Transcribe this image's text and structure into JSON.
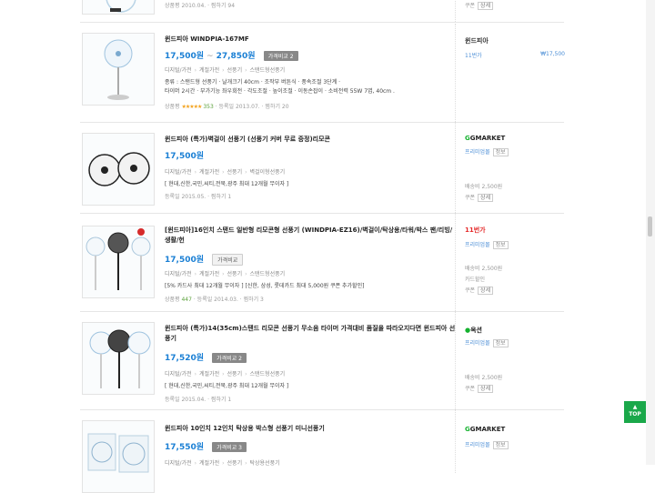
{
  "partial_top": {
    "meta": "상품평 2010.04.",
    "wish": "찜하기 94",
    "coupon": "쿠폰",
    "detail": "상세"
  },
  "items": [
    {
      "title": "윈드피아 WINDPIA-167MF",
      "price": "17,500원",
      "price_max": "27,850원",
      "compare": "가격비교 2",
      "category": [
        "디지털/가전",
        "계절가전",
        "선풍기",
        "스탠드형선풍기"
      ],
      "spec_lines": [
        "종류 : 스탠드형 선풍기 · 날개크기 40cm · 조작부 버튼식 · 풍속조절 3단계 ·",
        "타이머 2시간 · 부가기능 좌우회전 · 각도조절 · 높이조절 · 이동손잡이 · 소비전력 55W 7엽, 40cm ."
      ],
      "meta_label": "상품평",
      "review_count": "353",
      "stars": "★★★★★",
      "date": "등록일 2013.07.",
      "wish": "찜하기 20",
      "mall": "윈드피아",
      "mall_sub": "11번가",
      "mall_price": "₩17,500"
    },
    {
      "title": "윈드피아 (특가)벽걸이 선풍기 (선풍기 커버 무료 증정)리모콘",
      "price": "17,500원",
      "category": [
        "디지털/가전",
        "계절가전",
        "선풍기",
        "벽걸이형선풍기"
      ],
      "card": "[ 현대,신한,국민,씨티,전북,광주 최대 12개월 무이자 ]",
      "date": "등록일 2015.05.",
      "wish": "찜하기 1",
      "mall_brand": "GMARKET",
      "mall_sub": "프리미엄몰",
      "mall_tag": "정보",
      "ship": "배송비 2,500원",
      "coupon": "쿠폰",
      "detail": "상세"
    },
    {
      "title": "[윈드피아]16인치 스탠드 일반형 리모콘형 선풍기 (WINDPIA-EZ16)/벽걸이/탁상용/타워/박스 팬/리빙/생활/헌",
      "price": "17,500원",
      "compare": "가격비교",
      "category": [
        "디지털/가전",
        "계절가전",
        "선풍기",
        "스탠드형선풍기"
      ],
      "card": "[5% 카드사 최대 12개월 무이자 ] [신한, 삼성, 롯데카드 최대 5,000원 쿠폰 추가할인]",
      "meta_label": "상품평",
      "review_count": "447",
      "date": "등록일 2014.03.",
      "wish": "찜하기 3",
      "mall_brand": "11번가",
      "mall_sub": "프리미엄몰",
      "mall_tag": "정보",
      "ship": "배송비 2,500원",
      "card_note": "카드할인",
      "coupon": "쿠폰",
      "detail": "상세"
    },
    {
      "title": "윈드피아 (특가)14(35cm)스탠드 리모콘 선풍기 무소음 타이머 가격대비 품질을 따라오지다면 윈드피아 선풍기",
      "price": "17,520원",
      "compare": "가격비교 2",
      "category": [
        "디지털/가전",
        "계절가전",
        "선풍기",
        "스탠드형선풍기"
      ],
      "card": "[ 현대,신한,국민,씨티,전북,광주 최대 12개월 무이자 ]",
      "date": "등록일 2015.04.",
      "wish": "찜하기 1",
      "mall_brand": "옥션",
      "mall_sub": "프리미엄몰",
      "mall_tag": "정보",
      "ship": "배송비 2,500원",
      "coupon": "쿠폰",
      "detail": "상세"
    },
    {
      "title": "윈드피아 10인치 12인치 탁상용 박스형 선풍기 미니선풍기",
      "price": "17,550원",
      "compare": "가격비교 3",
      "category": [
        "디지털/가전",
        "계절가전",
        "선풍기",
        "탁상용선풍기"
      ],
      "mall_brand": "GMARKET",
      "mall_sub": "프리미엄몰",
      "mall_tag": "정보"
    }
  ],
  "top_button": {
    "arrow": "▲",
    "label": "TOP"
  },
  "colors": {
    "price": "#1a7fd4",
    "gmarket": "#14b12e",
    "top": "#1aa84a"
  }
}
